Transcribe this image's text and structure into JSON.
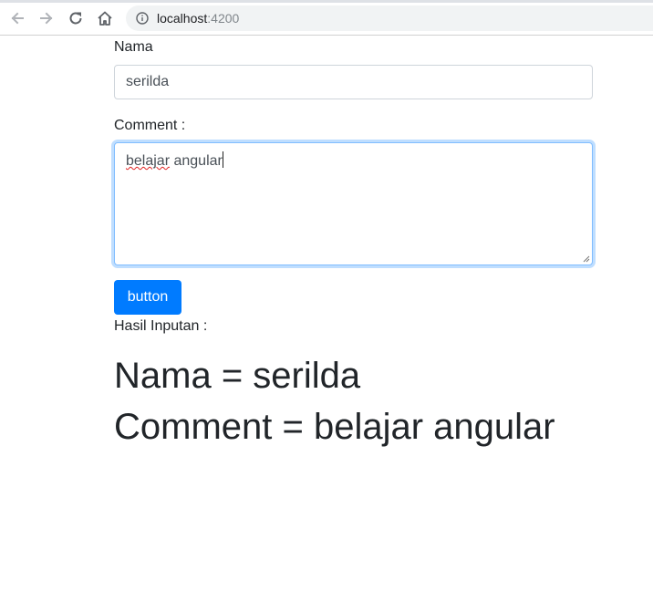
{
  "browser": {
    "url_host": "localhost",
    "url_port": ":4200",
    "icons": {
      "back": "arrow-left-icon",
      "forward": "arrow-right-icon",
      "reload": "reload-icon",
      "home": "home-icon",
      "site_info": "info-icon"
    }
  },
  "form": {
    "nama_label": "Nama",
    "nama_value": "serilda",
    "comment_label": "Comment :",
    "comment_value_misspelled": "belajar",
    "comment_value_rest": " angular",
    "button_label": "button"
  },
  "result": {
    "label": "Hasil Inputan :",
    "nama_line": "Nama = serilda",
    "comment_line": "Comment = belajar angular"
  },
  "colors": {
    "primary": "#007bff",
    "focus_border": "#80bdff",
    "text": "#212529"
  }
}
